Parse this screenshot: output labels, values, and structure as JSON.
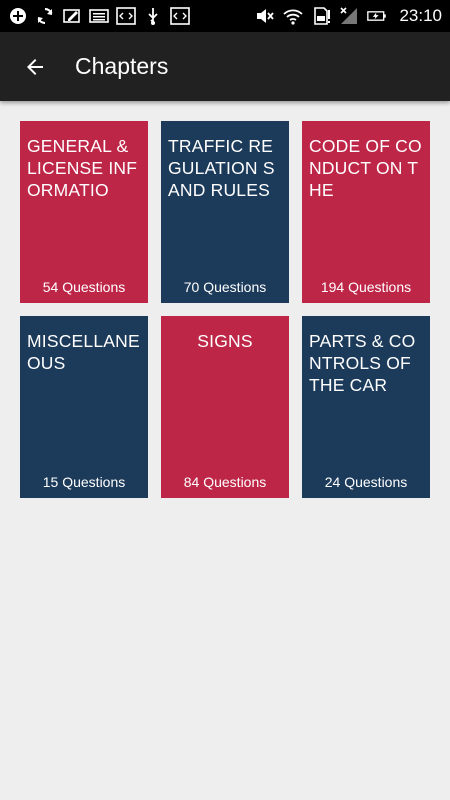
{
  "status_bar": {
    "time": "23:10",
    "icons": [
      "add-box-icon",
      "sync-icon",
      "edit-box-icon",
      "keyboard-icon",
      "code-icon",
      "usb-icon",
      "code-icon",
      "mute-icon",
      "wifi-icon",
      "sd-card-alert-icon",
      "signal-icon",
      "battery-charging-icon"
    ]
  },
  "app_bar": {
    "back_icon": "arrow-back-icon",
    "title": "Chapters"
  },
  "chapters": [
    {
      "title": "GENERAL & LICENSE INFORMATIO",
      "count": "54 Questions",
      "color": "#be2648"
    },
    {
      "title": "TRAFFIC REGULATION S AND RULES",
      "count": "70 Questions",
      "color": "#1c3a5a"
    },
    {
      "title": "CODE OF CONDUCT ON THE",
      "count": "194 Questions",
      "color": "#be2648"
    },
    {
      "title": "MISCELLANE OUS",
      "count": "15 Questions",
      "color": "#1c3a5a"
    },
    {
      "title": "SIGNS",
      "count": "84 Questions",
      "color": "#be2648"
    },
    {
      "title": "PARTS & CONTROLS OF THE CAR",
      "count": "24 Questions",
      "color": "#1c3a5a"
    }
  ]
}
